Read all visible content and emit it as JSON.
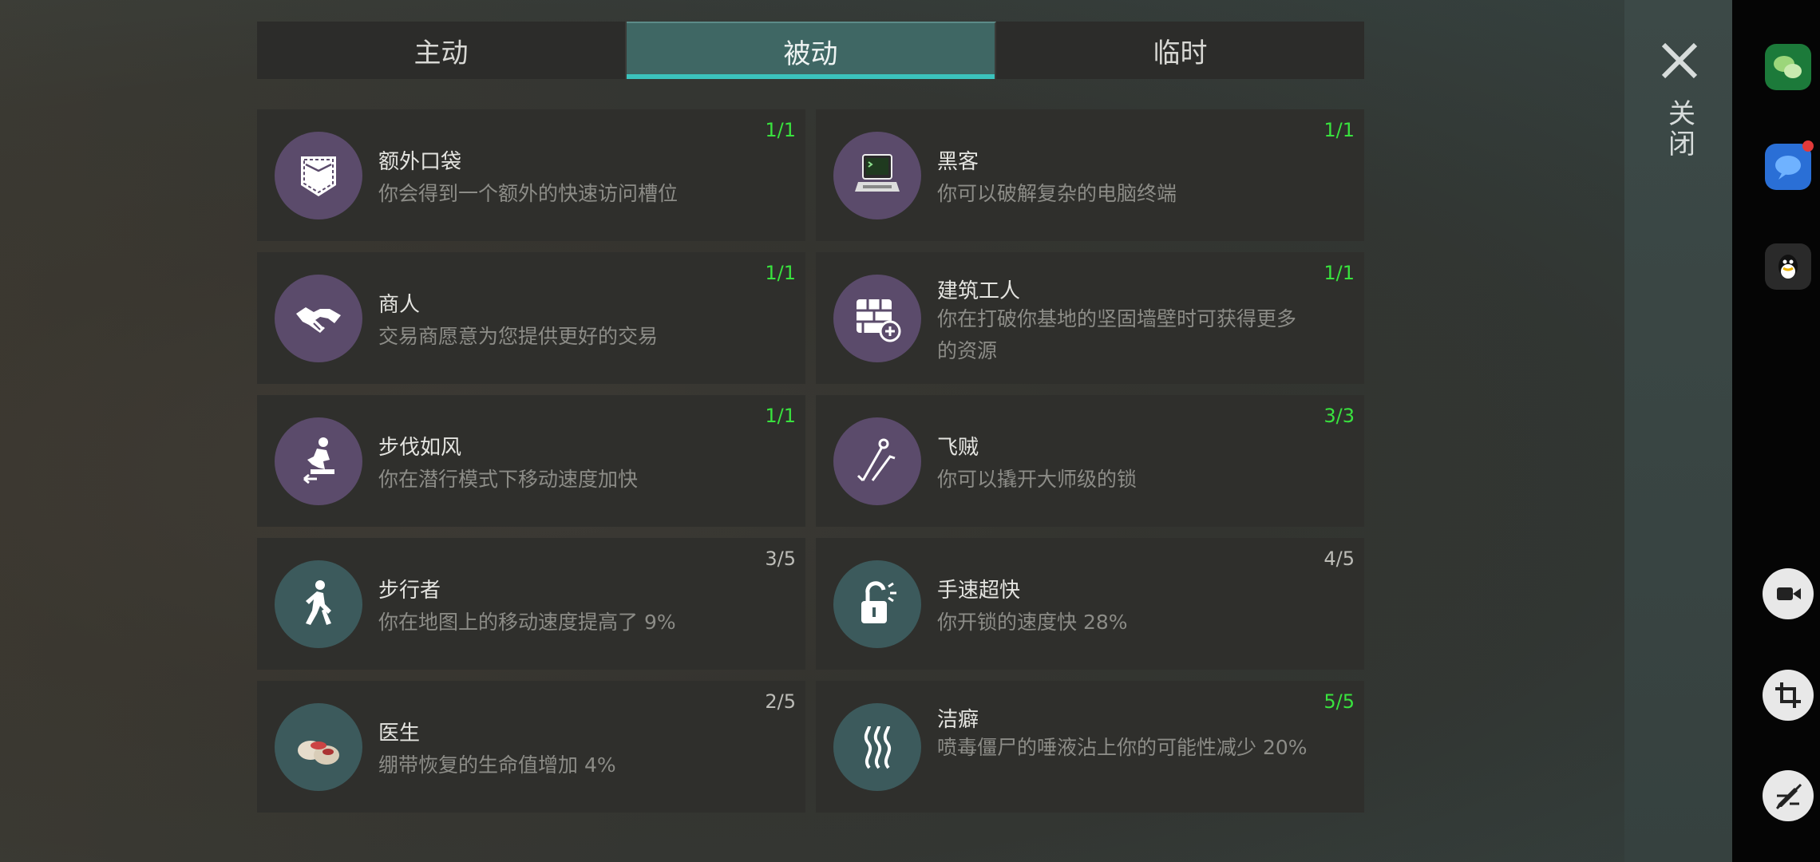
{
  "tabs": [
    {
      "label": "主动",
      "active": false
    },
    {
      "label": "被动",
      "active": true
    },
    {
      "label": "临时",
      "active": false
    }
  ],
  "perks": [
    {
      "title": "额外口袋",
      "desc": "你会得到一个额外的快速访问槽位",
      "level": "1/1",
      "maxed": true,
      "icon": "pocket-icon",
      "color": "purple"
    },
    {
      "title": "黑客",
      "desc": "你可以破解复杂的电脑终端",
      "level": "1/1",
      "maxed": true,
      "icon": "computer-terminal-icon",
      "color": "purple"
    },
    {
      "title": "商人",
      "desc": "交易商愿意为您提供更好的交易",
      "level": "1/1",
      "maxed": true,
      "icon": "handshake-icon",
      "color": "purple"
    },
    {
      "title": "建筑工人",
      "desc": "你在打破你基地的坚固墙壁时可获得更多的资源",
      "level": "1/1",
      "maxed": true,
      "icon": "brick-wall-plus-icon",
      "color": "purple"
    },
    {
      "title": "步伐如风",
      "desc": "你在潜行模式下移动速度加快",
      "level": "1/1",
      "maxed": true,
      "icon": "sneaking-figure-icon",
      "color": "purple"
    },
    {
      "title": "飞贼",
      "desc": "你可以撬开大师级的锁",
      "level": "3/3",
      "maxed": true,
      "icon": "lockpicks-icon",
      "color": "purple"
    },
    {
      "title": "步行者",
      "desc": "你在地图上的移动速度提高了 9%",
      "level": "3/5",
      "maxed": false,
      "icon": "walking-person-icon",
      "color": "teal"
    },
    {
      "title": "手速超快",
      "desc": "你开锁的速度快 28%",
      "level": "4/5",
      "maxed": false,
      "icon": "open-padlock-icon",
      "color": "teal"
    },
    {
      "title": "医生",
      "desc": "绷带恢复的生命值增加 4%",
      "level": "2/5",
      "maxed": false,
      "icon": "bandage-icon",
      "color": "teal"
    },
    {
      "title": "洁癖",
      "desc": "喷毒僵尸的唾液沾上你的可能性减少 20%",
      "level": "5/5",
      "maxed": true,
      "icon": "fumes-icon",
      "color": "teal"
    }
  ],
  "close": {
    "label": "关闭"
  },
  "colors": {
    "tab_active_bg": "#3f6764",
    "tab_indicator": "#3bc3bd",
    "level_max": "#39e23e",
    "level_normal": "#bdbdb8",
    "icon_purple": "#5b4b6b",
    "icon_teal": "#3c5a5c"
  },
  "toolbar": [
    "wechat-icon",
    "messages-icon",
    "qq-icon",
    "screen-record-icon",
    "crop-screenshot-icon",
    "edit-off-icon"
  ]
}
